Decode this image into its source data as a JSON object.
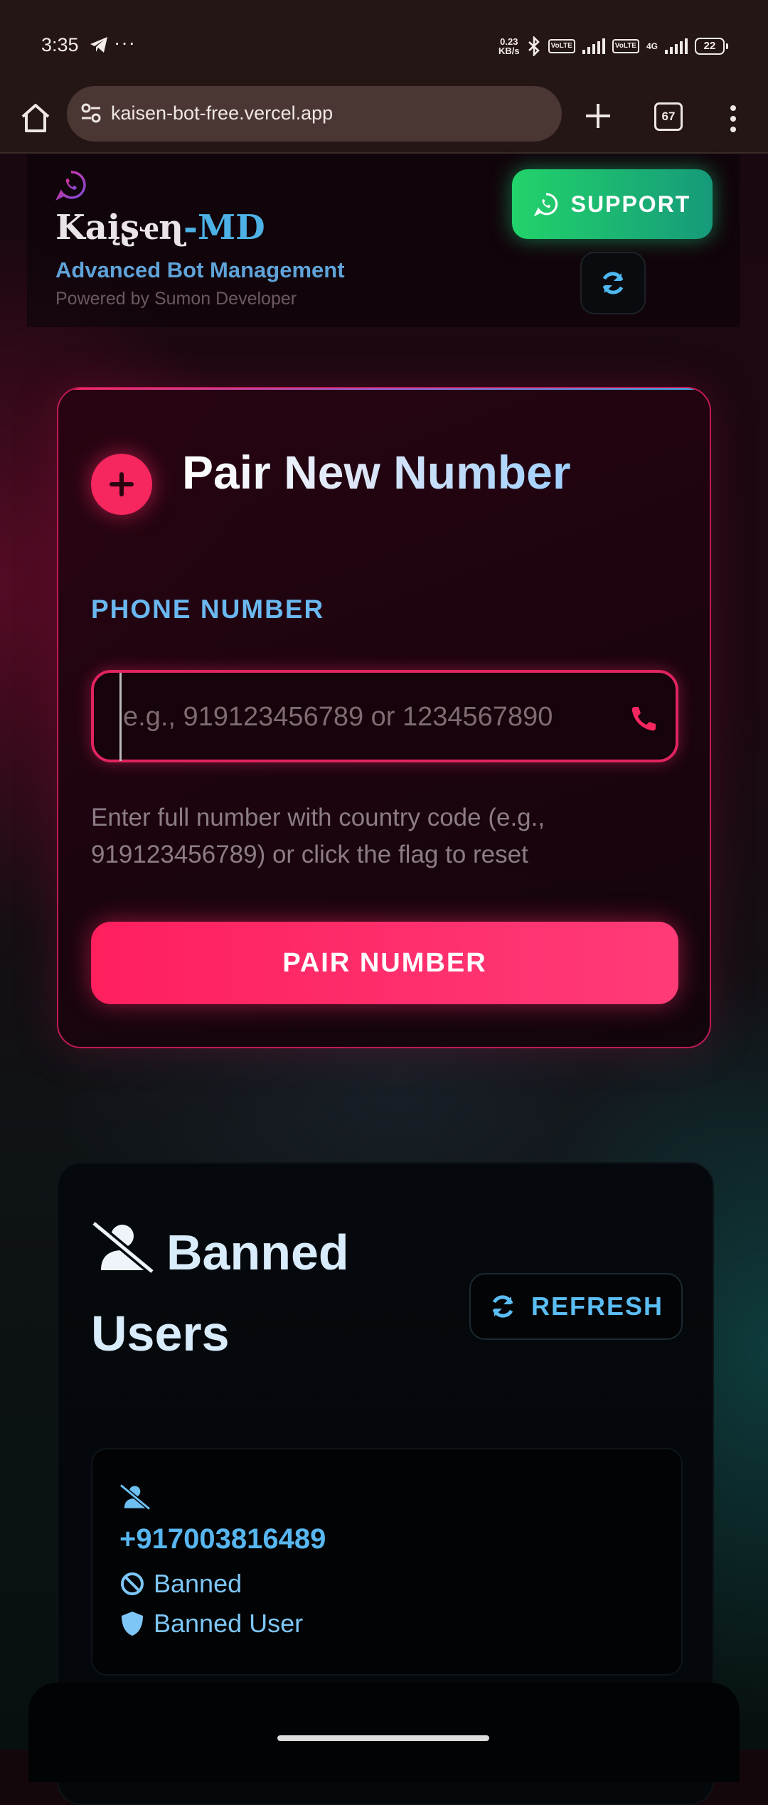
{
  "status_bar": {
    "time": "3:35",
    "net_speed_value": "0.23",
    "net_speed_unit": "KB/s",
    "sim1_tag": "VoLTE",
    "sim2_tag": "VoLTE",
    "network_type": "4G",
    "battery": "22"
  },
  "browser": {
    "url": "kaisen-bot-free.vercel.app",
    "tab_count": "67"
  },
  "header": {
    "brand_part1": "Kaįʂҽɳ",
    "brand_part2": "-MD",
    "subtitle": "Advanced Bot Management",
    "powered_by": "Powered by Sumon Developer",
    "support_label": "SUPPORT"
  },
  "pair_card": {
    "title": "Pair New Number",
    "phone_label": "PHONE NUMBER",
    "phone_placeholder": "e.g., 919123456789 or 1234567890",
    "phone_value": "",
    "hint": "Enter full number with country code (e.g., 919123456789) or click the flag to reset",
    "button_label": "PAIR NUMBER"
  },
  "banned_card": {
    "title": "Banned Users",
    "refresh_label": "REFRESH",
    "users": [
      {
        "number": "+917003816489",
        "status": "Banned",
        "role": "Banned User"
      }
    ]
  },
  "colors": {
    "accent_pink": "#f6265f",
    "accent_blue": "#58b6f0",
    "support_green": "#22d36a"
  }
}
